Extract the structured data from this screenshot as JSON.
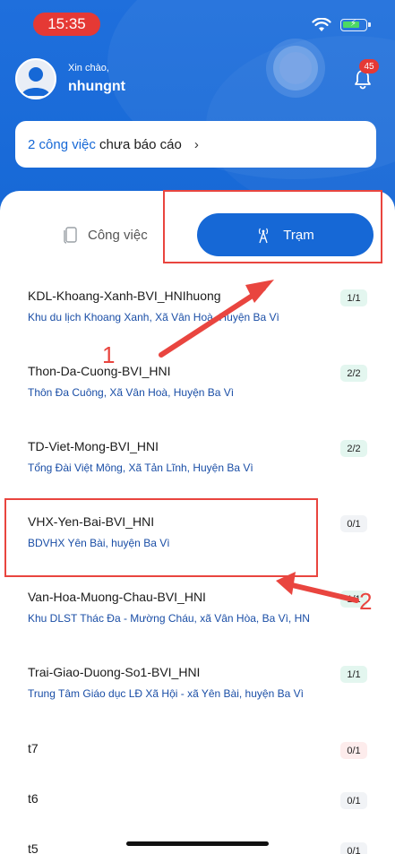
{
  "status_bar": {
    "time": "15:35"
  },
  "user": {
    "greeting": "Xin chào,",
    "name": "nhungnt"
  },
  "notifications": {
    "count": "45"
  },
  "report_card": {
    "count_text": "2 công việc",
    "rest_text": " chưa báo cáo",
    "chevron": "›"
  },
  "tabs": {
    "job": "Công việc",
    "station": "Trạm"
  },
  "stations": [
    {
      "title": "KDL-Khoang-Xanh-BVI_HNIhuong",
      "address": "Khu du lịch Khoang Xanh, Xã Vân Hoà, Huyện Ba Vì",
      "count": "1/1",
      "badge_color": "#e3f6ef"
    },
    {
      "title": "Thon-Da-Cuong-BVI_HNI",
      "address": "Thôn Đa Cuông, Xã Vân Hoà, Huyện Ba Vì",
      "count": "2/2",
      "badge_color": "#e3f6ef"
    },
    {
      "title": "TD-Viet-Mong-BVI_HNI",
      "address": "Tổng Đài Việt Mông, Xã Tản Lĩnh, Huyện Ba Vì",
      "count": "2/2",
      "badge_color": "#e3f6ef"
    },
    {
      "title": "VHX-Yen-Bai-BVI_HNI",
      "address": "BDVHX Yên Bài, huyện Ba Vì",
      "count": "0/1",
      "badge_color": "#f1f3f6"
    },
    {
      "title": "Van-Hoa-Muong-Chau-BVI_HNI",
      "address": "Khu DLST Thác Đa - Mường Cháu, xã Vân Hòa, Ba Vì, HN",
      "count": "1/1",
      "badge_color": "#e3f6ef"
    },
    {
      "title": "Trai-Giao-Duong-So1-BVI_HNI",
      "address": "Trung Tâm Giáo dục LĐ Xã Hội - xã Yên Bài, huyện Ba Vì",
      "count": "1/1",
      "badge_color": "#e3f6ef"
    },
    {
      "title": "t7",
      "address": "",
      "count": "0/1",
      "badge_color": "#fdecec"
    },
    {
      "title": "t6",
      "address": "",
      "count": "0/1",
      "badge_color": "#f1f3f6"
    },
    {
      "title": "t5",
      "address": "",
      "count": "0/1",
      "badge_color": "#f1f3f6"
    }
  ],
  "annotations": {
    "label_1": "1",
    "label_2": "2",
    "color": "#e9453f"
  },
  "colors": {
    "primary": "#1668d6",
    "badge_red": "#e53935"
  }
}
